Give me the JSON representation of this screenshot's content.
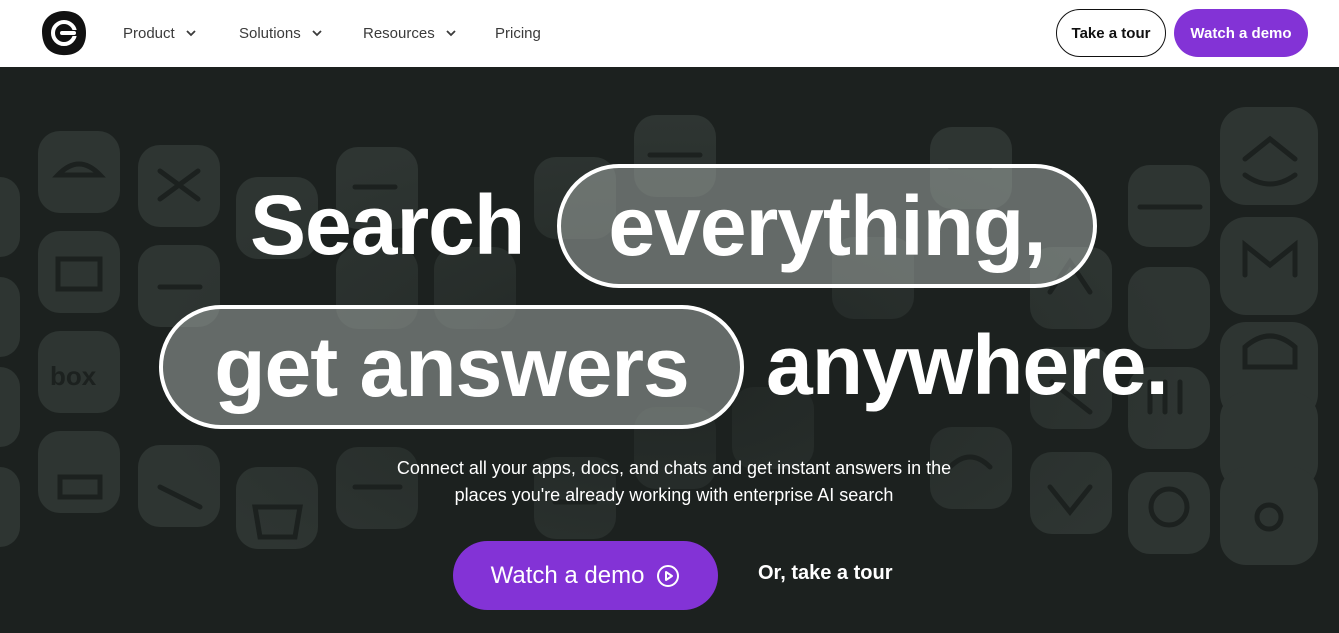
{
  "nav": {
    "items": [
      {
        "label": "Product",
        "has_dropdown": true
      },
      {
        "label": "Solutions",
        "has_dropdown": true
      },
      {
        "label": "Resources",
        "has_dropdown": true
      },
      {
        "label": "Pricing",
        "has_dropdown": false
      }
    ],
    "take_tour_label": "Take a tour",
    "watch_demo_label": "Watch a demo"
  },
  "hero": {
    "line1_plain": "Search",
    "line1_pill": "everything,",
    "line2_pill": "get answers",
    "line2_plain": "anywhere.",
    "subtext_line1": "Connect all your apps, docs, and chats and get instant answers in the",
    "subtext_line2": "places you're already working with enterprise AI search",
    "cta_demo_label": "Watch a demo",
    "cta_tour_label": "Or, take a tour"
  },
  "colors": {
    "accent": "#8333d6",
    "hero_bg": "#1c211f",
    "tile": "#2e3532"
  },
  "icons": {
    "logo": "brand-logo-icon",
    "dropdown": "chevron-down-icon",
    "play": "play-circle-icon"
  }
}
